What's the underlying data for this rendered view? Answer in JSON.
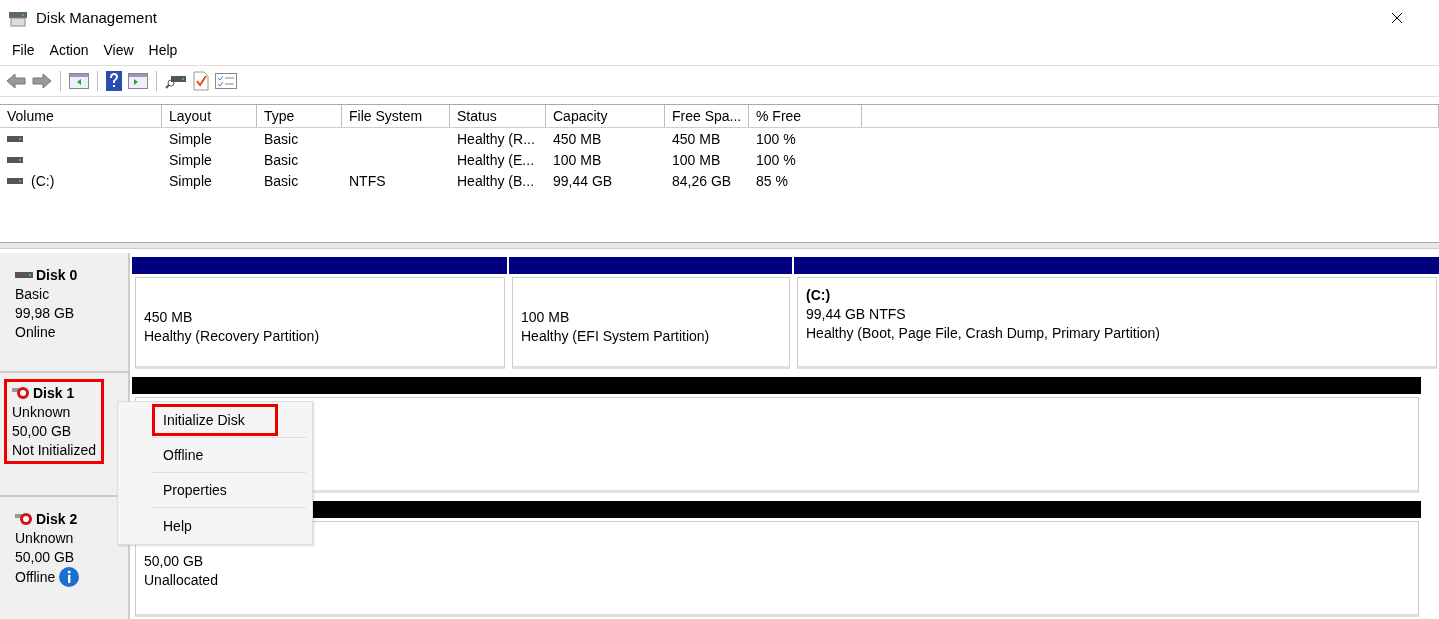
{
  "window": {
    "title": "Disk Management"
  },
  "menu": [
    "File",
    "Action",
    "View",
    "Help"
  ],
  "volumes": {
    "columns": [
      "Volume",
      "Layout",
      "Type",
      "File System",
      "Status",
      "Capacity",
      "Free Spa...",
      "% Free"
    ],
    "rows": [
      {
        "cells": [
          "",
          "Simple",
          "Basic",
          "",
          "Healthy (R...",
          "450 MB",
          "450 MB",
          "100 %"
        ]
      },
      {
        "cells": [
          "",
          "Simple",
          "Basic",
          "",
          "Healthy (E...",
          "100 MB",
          "100 MB",
          "100 %"
        ]
      },
      {
        "cells": [
          "(C:)",
          "Simple",
          "Basic",
          "NTFS",
          "Healthy (B...",
          "99,44 GB",
          "84,26 GB",
          "85 %"
        ]
      }
    ]
  },
  "disks": [
    {
      "name": "Disk 0",
      "kind": "online",
      "type": "Basic",
      "size": "99,98 GB",
      "status": "Online",
      "info": false,
      "highlighted": false,
      "partitions": [
        {
          "kind": "primary",
          "size": "450 MB",
          "status": "Healthy (Recovery Partition)"
        },
        {
          "kind": "primary",
          "size": "100 MB",
          "status": "Healthy (EFI System Partition)"
        },
        {
          "kind": "primary",
          "label": "(C:)",
          "size": "99,44 GB NTFS",
          "status": "Healthy (Boot, Page File, Crash Dump, Primary Partition)"
        }
      ]
    },
    {
      "name": "Disk 1",
      "kind": "error",
      "type": "Unknown",
      "size": "50,00 GB",
      "status": "Not Initialized",
      "info": false,
      "highlighted": true,
      "partitions": [
        {
          "kind": "unallocated"
        }
      ]
    },
    {
      "name": "Disk 2",
      "kind": "error",
      "type": "Unknown",
      "size": "50,00 GB",
      "status": "Offline",
      "info": true,
      "highlighted": false,
      "partitions": [
        {
          "kind": "unallocated",
          "size": "50,00 GB",
          "status": "Unallocated"
        }
      ]
    }
  ],
  "context_menu": {
    "items": [
      {
        "label": "Initialize Disk",
        "highlighted": true
      },
      {
        "label": "Offline",
        "highlighted": false
      },
      {
        "label": "Properties",
        "highlighted": false
      },
      {
        "label": "Help",
        "highlighted": false
      }
    ]
  }
}
